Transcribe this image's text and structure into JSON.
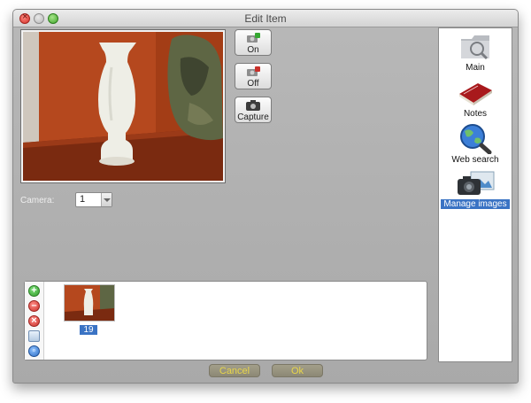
{
  "window": {
    "title": "Edit Item"
  },
  "camera_buttons": [
    {
      "label": "On",
      "icon": "camera-on-icon"
    },
    {
      "label": "Off",
      "icon": "camera-off-icon"
    },
    {
      "label": "Capture",
      "icon": "camera-icon"
    }
  ],
  "camera": {
    "label": "Camera:",
    "selected": "1"
  },
  "sidebar": {
    "items": [
      {
        "label": "Main",
        "icon": "folder-icon"
      },
      {
        "label": "Notes",
        "icon": "notebook-icon"
      },
      {
        "label": "Web search",
        "icon": "magnifier-globe-icon"
      },
      {
        "label": "Manage images",
        "icon": "camera-images-icon",
        "selected": true
      }
    ]
  },
  "thumbnails": [
    {
      "label": "19"
    }
  ],
  "footer": {
    "cancel_label": "Cancel",
    "ok_label": "Ok"
  },
  "colors": {
    "selection": "#3a73c4",
    "button_text": "#e8d64a"
  }
}
